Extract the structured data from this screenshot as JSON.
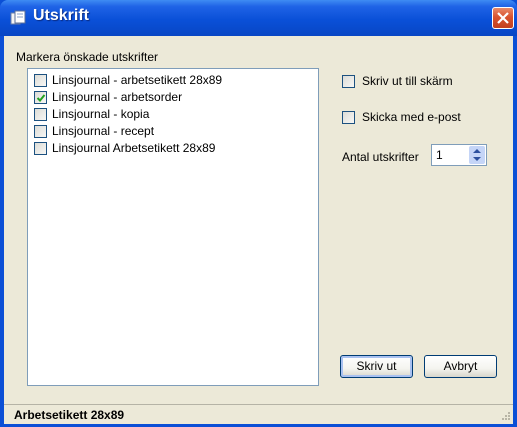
{
  "window": {
    "title": "Utskrift",
    "icons": {
      "app": "printer-document-icon",
      "close": "close-icon"
    }
  },
  "print_list": {
    "label": "Markera önskade utskrifter",
    "items": [
      {
        "label": "Linsjournal - arbetsetikett 28x89",
        "checked": false
      },
      {
        "label": "Linsjournal - arbetsorder",
        "checked": true
      },
      {
        "label": "Linsjournal - kopia",
        "checked": false
      },
      {
        "label": "Linsjournal - recept",
        "checked": false
      },
      {
        "label": "Linsjournal Arbetsetikett 28x89",
        "checked": false
      }
    ]
  },
  "options": {
    "print_to_screen": {
      "label": "Skriv ut till skärm",
      "checked": false
    },
    "send_email": {
      "label": "Skicka med e-post",
      "checked": false
    }
  },
  "copies": {
    "label": "Antal utskrifter",
    "value": "1"
  },
  "buttons": {
    "print": "Skriv ut",
    "cancel": "Avbryt"
  },
  "status_bar": {
    "text": "Arbetsetikett 28x89"
  },
  "colors": {
    "title_bar": "#0a50d8",
    "face": "#ece9d8",
    "close_button": "#d8532f",
    "check": "#21a121"
  }
}
